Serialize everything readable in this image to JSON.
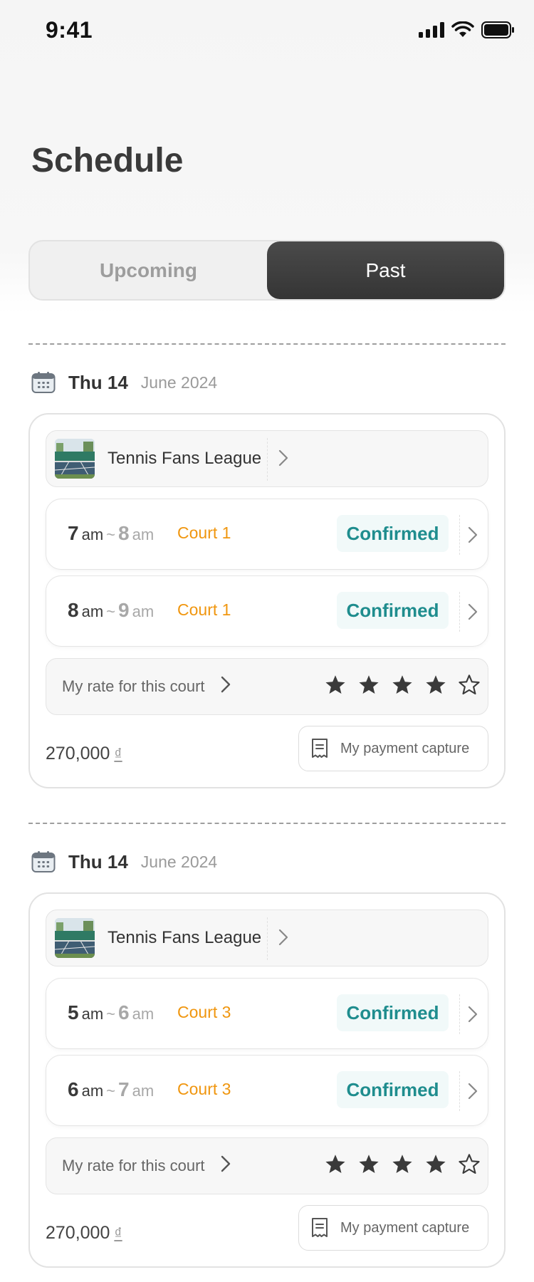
{
  "status_bar": {
    "time": "9:41"
  },
  "page": {
    "title": "Schedule"
  },
  "tabs": [
    {
      "label": "Upcoming",
      "active": false
    },
    {
      "label": "Past",
      "active": true
    }
  ],
  "colors": {
    "accent_orange": "#f0960f",
    "confirmed_teal": "#1f8d8e",
    "tab_active_bg": "#3d3d3d"
  },
  "bookings": [
    {
      "date_day": "Thu 14",
      "date_month": "June 2024",
      "league_name": "Tennis Fans League",
      "slots": [
        {
          "start_hour": "7",
          "start_period": "am",
          "sep": "~",
          "end_hour": "8",
          "end_period": "am",
          "court": "Court 1",
          "status": "Confirmed"
        },
        {
          "start_hour": "8",
          "start_period": "am",
          "sep": "~",
          "end_hour": "9",
          "end_period": "am",
          "court": "Court 1",
          "status": "Confirmed"
        }
      ],
      "rate_label": "My rate for this court",
      "rating": 4,
      "rating_max": 5,
      "price": "270,000",
      "currency": "₫",
      "payment_label": "My payment capture"
    },
    {
      "date_day": "Thu 14",
      "date_month": "June 2024",
      "league_name": "Tennis Fans League",
      "slots": [
        {
          "start_hour": "5",
          "start_period": "am",
          "sep": "~",
          "end_hour": "6",
          "end_period": "am",
          "court": "Court 3",
          "status": "Confirmed"
        },
        {
          "start_hour": "6",
          "start_period": "am",
          "sep": "~",
          "end_hour": "7",
          "end_period": "am",
          "court": "Court 3",
          "status": "Confirmed"
        }
      ],
      "rate_label": "My rate for this court",
      "rating": 4,
      "rating_max": 5,
      "price": "270,000",
      "currency": "₫",
      "payment_label": "My payment capture"
    }
  ]
}
